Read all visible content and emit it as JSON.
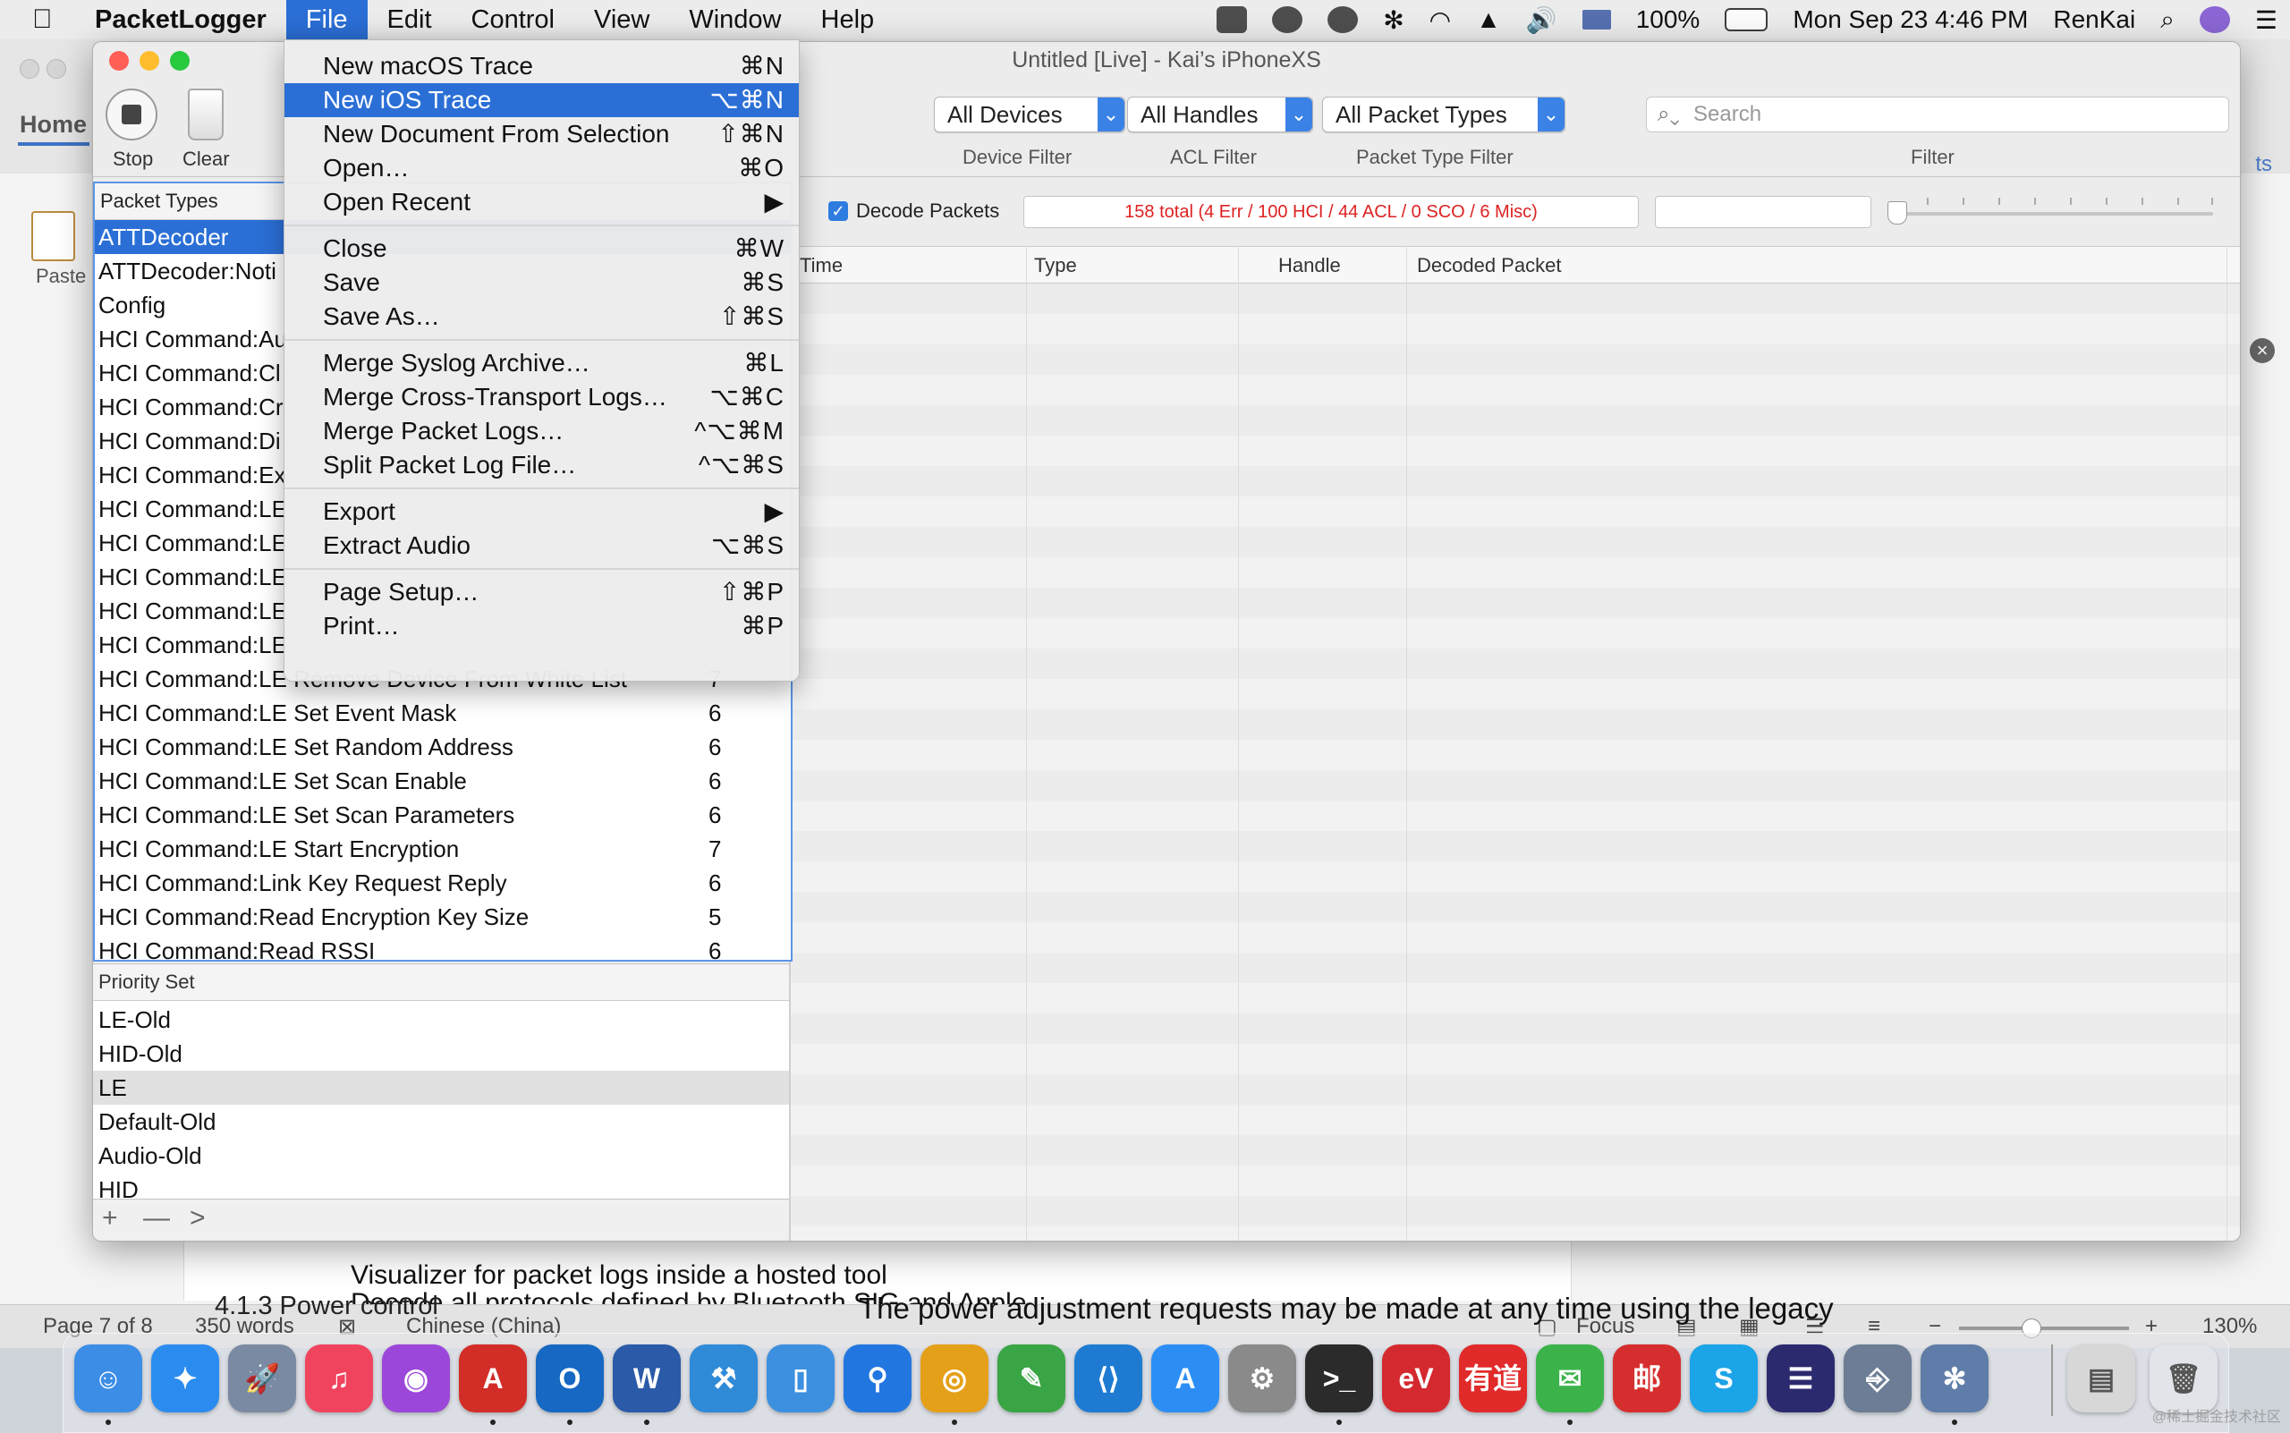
{
  "menubar": {
    "app": "PacketLogger",
    "items": [
      "File",
      "Edit",
      "Control",
      "View",
      "Window",
      "Help"
    ],
    "battery": "100%",
    "datetime": "Mon Sep 23  4:46 PM",
    "user": "RenKai"
  },
  "file_menu": {
    "items": [
      {
        "label": "New macOS Trace",
        "shortcut": "⌘N"
      },
      {
        "label": "New iOS Trace",
        "shortcut": "⌥⌘N"
      },
      {
        "label": "New Document From Selection",
        "shortcut": "⇧⌘N"
      },
      {
        "label": "Open…",
        "shortcut": "⌘O"
      },
      {
        "label": "Open Recent",
        "shortcut": "▶"
      },
      {
        "label": "Close",
        "shortcut": "⌘W"
      },
      {
        "label": "Save",
        "shortcut": "⌘S"
      },
      {
        "label": "Save As…",
        "shortcut": "⇧⌘S"
      },
      {
        "label": "Merge Syslog Archive…",
        "shortcut": "⌘L"
      },
      {
        "label": "Merge Cross-Transport Logs…",
        "shortcut": "⌥⌘C"
      },
      {
        "label": "Merge Packet Logs…",
        "shortcut": "^⌥⌘M"
      },
      {
        "label": "Split Packet Log File…",
        "shortcut": "^⌥⌘S"
      },
      {
        "label": "Export",
        "shortcut": "▶"
      },
      {
        "label": "Extract Audio",
        "shortcut": "⌥⌘S"
      },
      {
        "label": "Page Setup…",
        "shortcut": "⇧⌘P"
      },
      {
        "label": "Print…",
        "shortcut": "⌘P"
      }
    ]
  },
  "packetlogger": {
    "title": "Untitled [Live] - Kai’s iPhoneXS",
    "stop_label": "Stop",
    "clear_label": "Clear",
    "device_filter": "All Devices",
    "acl_filter": "All Handles",
    "packet_type_filter": "All Packet Types",
    "device_filter_label": "Device Filter",
    "acl_filter_label": "ACL Filter",
    "packet_type_filter_label": "Packet Type Filter",
    "filter_label": "Filter",
    "search_placeholder": "Search",
    "decode_packets_label": "Decode Packets",
    "counts": "158 total (4 Err / 100 HCI / 44 ACL / 0 SCO / 6 Misc)",
    "packet_types_header": "Packet Types",
    "packet_types": [
      {
        "name": "ATTDecoder",
        "count": ""
      },
      {
        "name": "ATTDecoder:Noti",
        "count": ""
      },
      {
        "name": "Config",
        "count": ""
      },
      {
        "name": "HCI Command:Au",
        "count": ""
      },
      {
        "name": "HCI Command:Cl",
        "count": ""
      },
      {
        "name": "HCI Command:Cr",
        "count": ""
      },
      {
        "name": "HCI Command:Di",
        "count": ""
      },
      {
        "name": "HCI Command:Ex",
        "count": ""
      },
      {
        "name": "HCI Command:LE",
        "count": ""
      },
      {
        "name": "HCI Command:LE",
        "count": ""
      },
      {
        "name": "HCI Command:LE",
        "count": ""
      },
      {
        "name": "HCI Command:LE",
        "count": ""
      },
      {
        "name": "HCI Command:LE",
        "count": ""
      },
      {
        "name": "HCI Command:LE Remove Device From White List",
        "count": "7"
      },
      {
        "name": "HCI Command:LE Set Event Mask",
        "count": "6"
      },
      {
        "name": "HCI Command:LE Set Random Address",
        "count": "6"
      },
      {
        "name": "HCI Command:LE Set Scan Enable",
        "count": "6"
      },
      {
        "name": "HCI Command:LE Set Scan Parameters",
        "count": "6"
      },
      {
        "name": "HCI Command:LE Start Encryption",
        "count": "7"
      },
      {
        "name": "HCI Command:Link Key Request Reply",
        "count": "6"
      },
      {
        "name": "HCI Command:Read Encryption Key Size",
        "count": "5"
      },
      {
        "name": "HCI Command:Read RSSI",
        "count": "6"
      }
    ],
    "priority_set_header": "Priority Set",
    "priority_sets": [
      "LE-Old",
      "HID-Old",
      "LE",
      "Default-Old",
      "Audio-Old",
      "HID"
    ],
    "footer_buttons": [
      "+",
      "—",
      ">"
    ],
    "columns": [
      "Time",
      "Type",
      "Handle",
      "Decoded Packet"
    ]
  },
  "word": {
    "tab_home": "Home",
    "paste": "Paste",
    "ts": "ts",
    "status": {
      "page": "Page 7 of 8",
      "words": "350 words",
      "language": "Chinese (China)",
      "focus": "Focus",
      "zoom": "130%"
    },
    "zoom_level": 0.42,
    "doc_fragments": [
      "Visualizer for packet logs inside a hosted tool",
      "Decode all protocols defined by Bluetooth SIG and Apple",
      "4.1.3 Power control",
      "The power adjustment requests may be made at any time using the legacy"
    ]
  },
  "dock": {
    "apps": [
      {
        "name": "finder-icon",
        "color": "#3b8de6",
        "glyph": "☺",
        "running": true
      },
      {
        "name": "safari-icon",
        "color": "#2b8cf0",
        "glyph": "✦",
        "running": false
      },
      {
        "name": "launchpad-icon",
        "color": "#7b8aa3",
        "glyph": "🚀",
        "running": false
      },
      {
        "name": "music-icon",
        "color": "#f0445e",
        "glyph": "♫",
        "running": false
      },
      {
        "name": "podcasts-icon",
        "color": "#9b47d9",
        "glyph": "◉",
        "running": false
      },
      {
        "name": "pdf-reader-icon",
        "color": "#d22d27",
        "glyph": "A",
        "running": true
      },
      {
        "name": "outlook-icon",
        "color": "#1668c2",
        "glyph": "O",
        "running": true
      },
      {
        "name": "word-icon",
        "color": "#2a5aa8",
        "glyph": "W",
        "running": true
      },
      {
        "name": "xcode-icon",
        "color": "#2f8ad8",
        "glyph": "⚒",
        "running": false
      },
      {
        "name": "simulator-icon",
        "color": "#3d90e0",
        "glyph": "▯",
        "running": false
      },
      {
        "name": "maps-pin-icon",
        "color": "#2276e0",
        "glyph": "⚲",
        "running": false
      },
      {
        "name": "chrome-icon",
        "color": "#e5a019",
        "glyph": "◎",
        "running": true
      },
      {
        "name": "evernote-icon",
        "color": "#3aa545",
        "glyph": "✎",
        "running": false
      },
      {
        "name": "vscode-icon",
        "color": "#1e7bd1",
        "glyph": "⟨⟩",
        "running": false
      },
      {
        "name": "app-store-icon",
        "color": "#2c8ef5",
        "glyph": "A",
        "running": false
      },
      {
        "name": "system-prefs-icon",
        "color": "#8a8a8a",
        "glyph": "⚙",
        "running": false
      },
      {
        "name": "terminal-icon",
        "color": "#2b2b2b",
        "glyph": ">_",
        "running": true
      },
      {
        "name": "expressvpn-icon",
        "color": "#d3292f",
        "glyph": "eV",
        "running": false
      },
      {
        "name": "youdao-icon",
        "color": "#e12a2a",
        "glyph": "有道",
        "running": false
      },
      {
        "name": "wechat-icon",
        "color": "#3bb34a",
        "glyph": "✉",
        "running": true
      },
      {
        "name": "mail-app-icon",
        "color": "#d62e2e",
        "glyph": "邮",
        "running": false
      },
      {
        "name": "skype-icon",
        "color": "#1ca4e8",
        "glyph": "S",
        "running": false
      },
      {
        "name": "eclipse-icon",
        "color": "#2c2a6e",
        "glyph": "☰",
        "running": false
      },
      {
        "name": "usb-tool-icon",
        "color": "#6c7d95",
        "glyph": "⎆",
        "running": false
      },
      {
        "name": "bluetooth-explorer-icon",
        "color": "#5f7da8",
        "glyph": "✻",
        "running": true
      }
    ],
    "trash_items": [
      {
        "name": "downloads-stack-icon",
        "color": "#d7d7d7",
        "glyph": "▤"
      },
      {
        "name": "trash-icon",
        "color": "#e1e4e8",
        "glyph": "🗑"
      }
    ]
  },
  "colors": {
    "accent": "#2b6fd6",
    "counts_text": "#dd2222",
    "close": "#ff5f56",
    "minimize": "#ffbd2e",
    "zoom": "#27c93f"
  }
}
